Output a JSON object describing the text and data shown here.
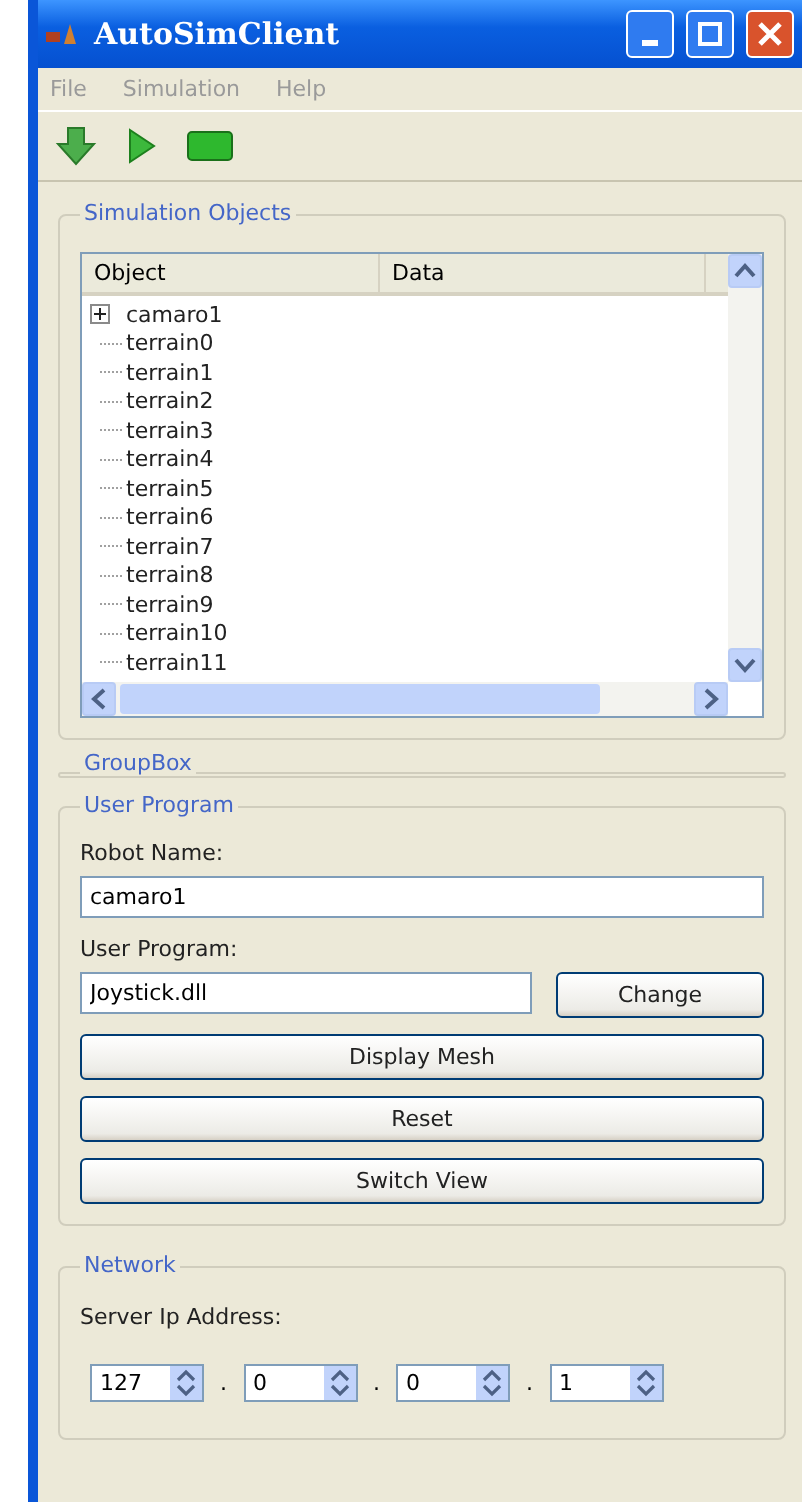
{
  "window": {
    "title": "AutoSimClient"
  },
  "menu": [
    "File",
    "Simulation",
    "Help"
  ],
  "simulation_objects": {
    "title": "Simulation Objects",
    "columns": [
      "Object",
      "Data"
    ],
    "items": [
      {
        "label": "camaro1",
        "expanded": false
      },
      {
        "label": "terrain0"
      },
      {
        "label": "terrain1"
      },
      {
        "label": "terrain2"
      },
      {
        "label": "terrain3"
      },
      {
        "label": "terrain4"
      },
      {
        "label": "terrain5"
      },
      {
        "label": "terrain6"
      },
      {
        "label": "terrain7"
      },
      {
        "label": "terrain8"
      },
      {
        "label": "terrain9"
      },
      {
        "label": "terrain10"
      },
      {
        "label": "terrain11"
      }
    ]
  },
  "group_box": {
    "title": "GroupBox"
  },
  "user_program": {
    "title": "User Program",
    "robot_name_label": "Robot Name:",
    "robot_name": "camaro1",
    "program_label": "User Program:",
    "program": "Joystick.dll",
    "change_button": "Change",
    "buttons": [
      "Display Mesh",
      "Reset",
      "Switch View"
    ]
  },
  "network": {
    "title": "Network",
    "label": "Server Ip Address:",
    "octets": [
      "127",
      "0",
      "0",
      "1"
    ],
    "separator": "."
  }
}
